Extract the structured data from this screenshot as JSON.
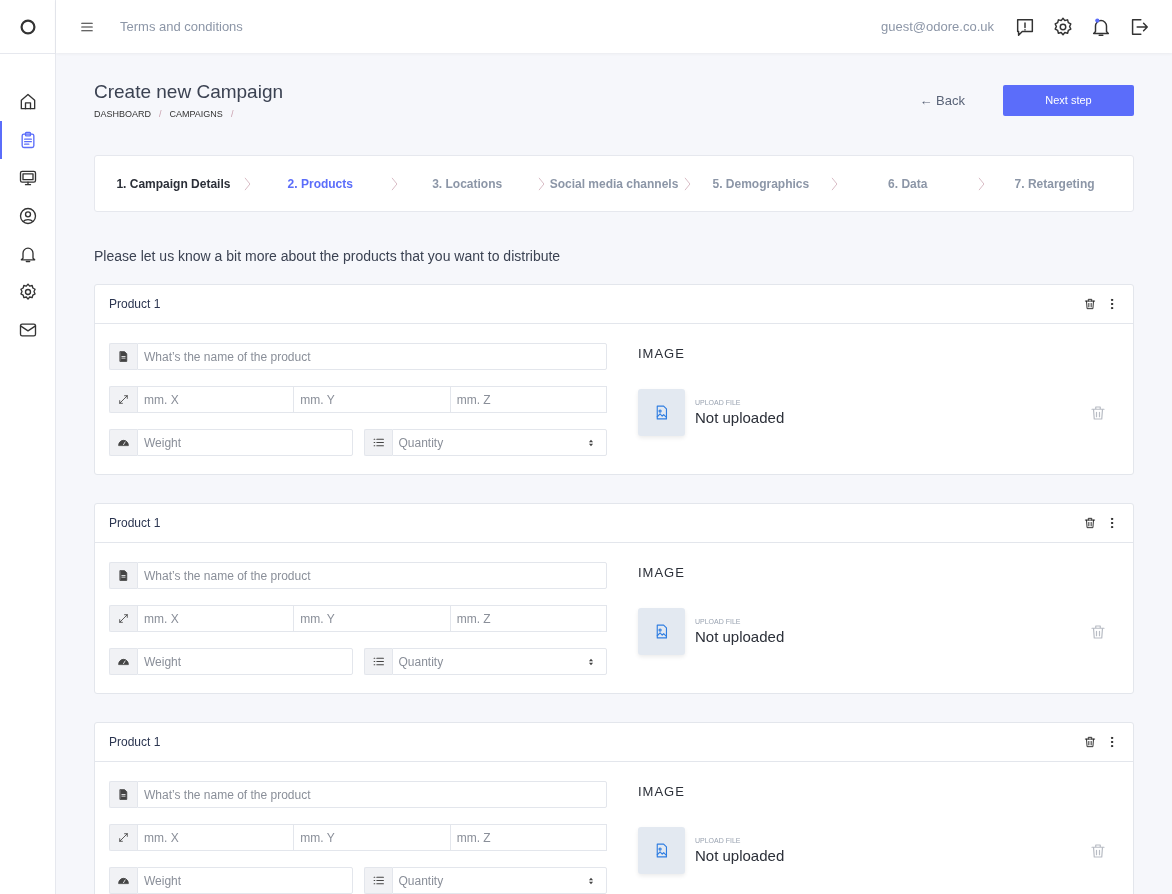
{
  "sidebar": {
    "items": [
      {
        "kind": "home",
        "selected": false
      },
      {
        "kind": "clipboard",
        "selected": true
      },
      {
        "kind": "monitor",
        "selected": false
      },
      {
        "kind": "user",
        "selected": false
      },
      {
        "kind": "bell",
        "selected": false
      },
      {
        "kind": "gear",
        "selected": false
      },
      {
        "kind": "mail",
        "selected": false
      }
    ]
  },
  "topbar": {
    "link": "Terms and conditions",
    "user": "guest@odore.co.uk",
    "has_notification": true
  },
  "header": {
    "title": "Create new Campaign",
    "breadcrumb": [
      {
        "label": "DASHBOARD",
        "separator": "/"
      },
      {
        "label": "CAMPAIGNS",
        "separator": "/"
      }
    ],
    "back": "← Back",
    "next": "Next step"
  },
  "steps": [
    {
      "label": "1. Campaign Details",
      "completed": true,
      "selected": false
    },
    {
      "label": "2. Products",
      "completed": false,
      "selected": true
    },
    {
      "label": "3. Locations",
      "completed": false,
      "selected": false
    },
    {
      "label": "Social media channels",
      "completed": false,
      "selected": false
    },
    {
      "label": "5. Demographics",
      "completed": false,
      "selected": false
    },
    {
      "label": "6. Data",
      "completed": false,
      "selected": false
    },
    {
      "label": "7. Retargeting",
      "completed": false,
      "selected": false
    }
  ],
  "intro": "Please let us know a bit more about the products that you want to distribute",
  "products": [
    {
      "title": "Product 1",
      "name_placeholder": "What’s the name of the product",
      "dim_placeholders": [
        "mm. X",
        "mm. Y",
        "mm. Z"
      ],
      "weight_placeholder": "Weight",
      "quantity_select": "Quantity",
      "image_label": "IMAGE",
      "upload_label": "UPLOAD FILE",
      "upload_status": "Not uploaded"
    },
    {
      "title": "Product 1",
      "name_placeholder": "What’s the name of the product",
      "dim_placeholders": [
        "mm. X",
        "mm. Y",
        "mm. Z"
      ],
      "weight_placeholder": "Weight",
      "quantity_select": "Quantity",
      "image_label": "IMAGE",
      "upload_label": "UPLOAD FILE",
      "upload_status": "Not uploaded"
    },
    {
      "title": "Product 1",
      "name_placeholder": "What’s the name of the product",
      "dim_placeholders": [
        "mm. X",
        "mm. Y",
        "mm. Z"
      ],
      "weight_placeholder": "Weight",
      "quantity_select": "Quantity",
      "image_label": "IMAGE",
      "upload_label": "UPLOAD FILE",
      "upload_status": "Not uploaded"
    }
  ]
}
